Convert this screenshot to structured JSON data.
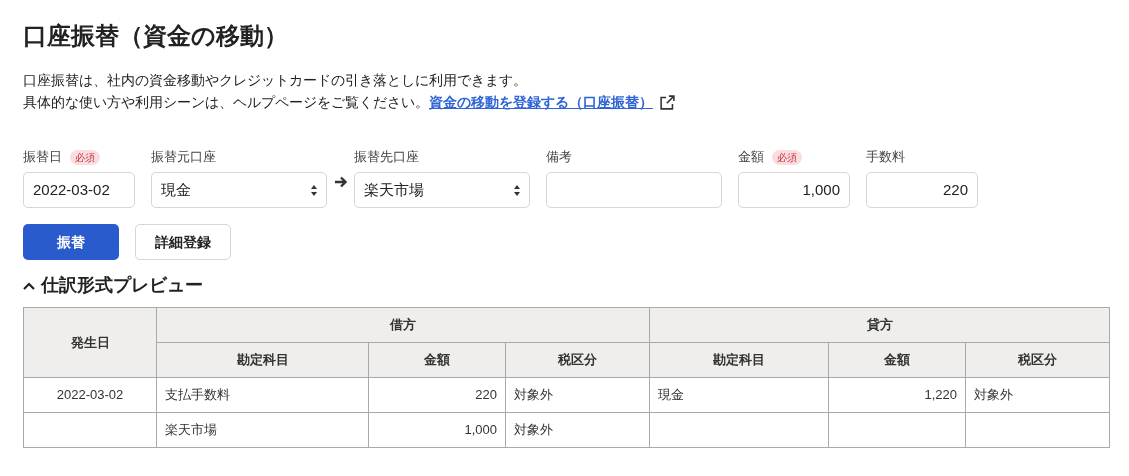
{
  "title": "口座振替（資金の移動）",
  "description": {
    "lines": [
      "口座振替は、社内の資金移動やクレジットカードの引き落としに利用できます。",
      "具体的な使い方や利用シーンは、ヘルプページをご覧ください。"
    ],
    "link": "資金の移動を登録する（口座振替）"
  },
  "fields": [
    {
      "label": "振替日",
      "badge": "必須",
      "kind": "date",
      "value": "2022-03-02",
      "arrow_before": false
    },
    {
      "label": "振替元口座",
      "kind": "select",
      "value": "現金",
      "arrow_before": false
    },
    {
      "label": "振替先口座",
      "kind": "select",
      "value": "楽天市場",
      "arrow_before": true
    },
    {
      "label": "備考",
      "kind": "text",
      "arrow_before": false
    },
    {
      "label": "金額",
      "badge": "必須",
      "kind": "number",
      "value": "1,000",
      "arrow_before": false
    },
    {
      "label": "手数料",
      "kind": "number",
      "value": "220",
      "arrow_before": false
    }
  ],
  "buttons": [
    {
      "label": "振替",
      "kind": "primary"
    },
    {
      "label": "詳細登録",
      "kind": "secondary"
    }
  ],
  "preview": {
    "title": "仕訳形式プレビュー",
    "expanded": true,
    "table": {
      "date_column": "発生日",
      "groups": [
        {
          "label": "借方",
          "columns": [
            {
              "label": "勘定科目",
              "kind": "text"
            },
            {
              "label": "金額",
              "kind": "amount"
            },
            {
              "label": "税区分",
              "kind": "text"
            }
          ]
        },
        {
          "label": "貸方",
          "columns": [
            {
              "label": "勘定科目",
              "kind": "text"
            },
            {
              "label": "金額",
              "kind": "amount"
            },
            {
              "label": "税区分",
              "kind": "text"
            }
          ]
        }
      ],
      "rows": [
        {
          "date": "2022-03-02",
          "cells": [
            "支払手数料",
            "220",
            "対象外",
            "現金",
            "1,220",
            "対象外"
          ]
        },
        {
          "date": null,
          "cells": [
            "楽天市場",
            "1,000",
            "対象外",
            null,
            null,
            null
          ]
        }
      ]
    }
  }
}
